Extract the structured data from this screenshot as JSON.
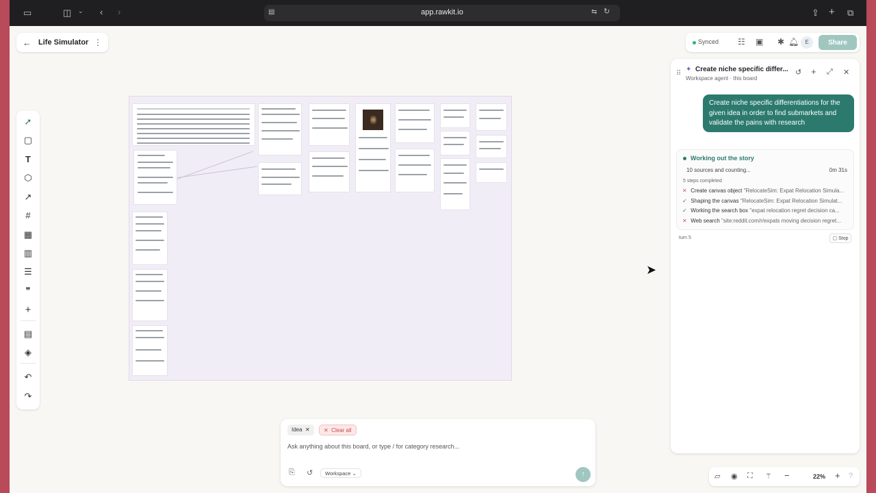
{
  "browser": {
    "url": "app.rawkit.io"
  },
  "header": {
    "title": "Life Simulator"
  },
  "status": {
    "synced_label": "Synced",
    "avatar_initial": "E",
    "share_label": "Share"
  },
  "agent": {
    "title": "Create niche specific differ...",
    "subtitle": "Workspace agent · this board",
    "user_message": "Create niche specific differentiations for the given idea in order to find submarkets and validate the pains with research",
    "progress": {
      "heading": "Working out the story",
      "sources": "10 sources and counting...",
      "elapsed": "0m 31s",
      "steps_completed": "5 steps completed",
      "steps": [
        {
          "label": "Create canvas object",
          "detail": "\"RelocateSim: Expat Relocation Simula...",
          "status": "failed"
        },
        {
          "label": "Shaping the canvas",
          "detail": "\"RelocateSim: Expat Relocation Simulat...",
          "status": "done"
        },
        {
          "label": "Working the search box",
          "detail": "\"expat relocation regret decision ca...",
          "status": "done"
        },
        {
          "label": "Web search",
          "detail": "\"site:reddit.com/r/expats moving decision regret...",
          "status": "failed"
        }
      ]
    },
    "turn_label": "turn 5",
    "stop_label": "Stop"
  },
  "prompt": {
    "chips": {
      "idea": "Idea",
      "clear_all": "Clear all"
    },
    "placeholder": "Ask anything about this board, or type / for category research...",
    "workspace_label": "Workspace"
  },
  "zoom": {
    "level": "22%"
  },
  "colors": {
    "accent": "#2c7a6e",
    "danger": "#d25656",
    "synced": "#2fb66a"
  }
}
